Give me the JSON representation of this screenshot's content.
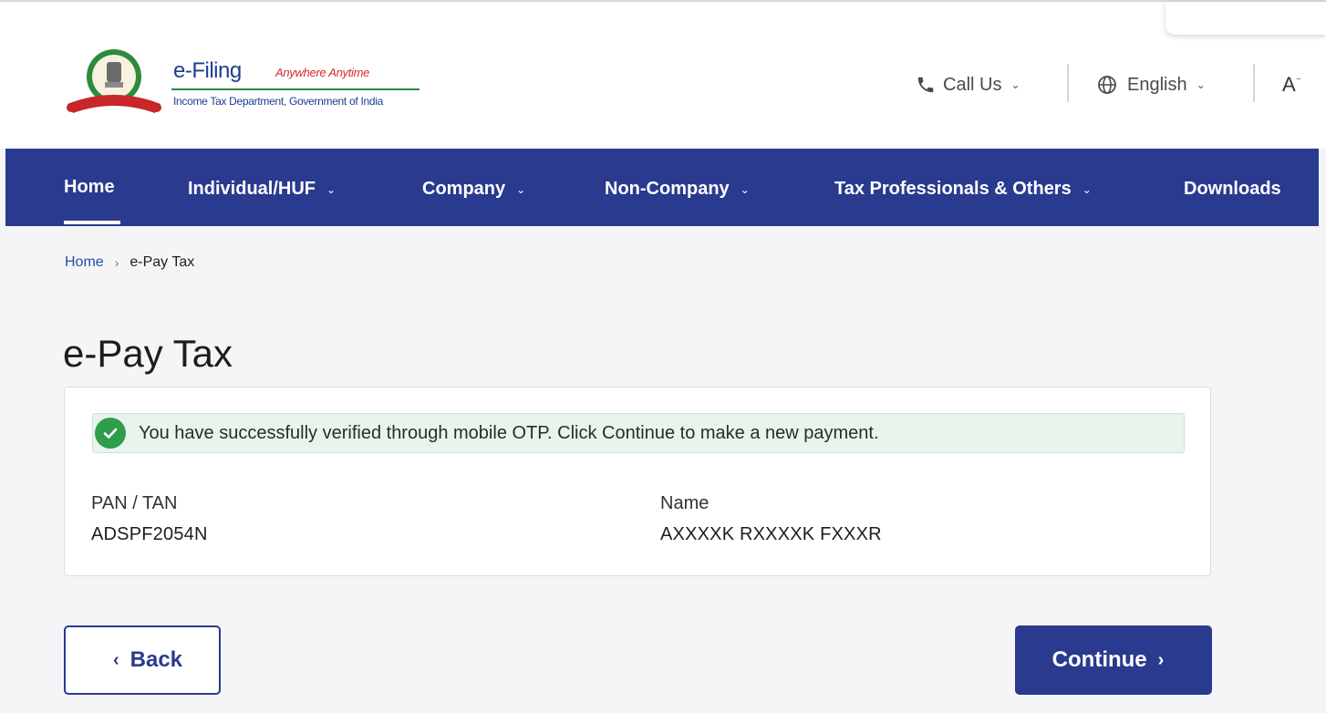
{
  "header": {
    "logo": {
      "title": "e-Filing",
      "tagline": "Anywhere Anytime",
      "subtitle": "Income Tax Department, Government of India"
    },
    "call_us": "Call Us",
    "language": "English",
    "font_size_icon": "A",
    "icons": {
      "call": "phone-icon",
      "language": "globe-icon",
      "font_size": "text-size-icon"
    }
  },
  "nav": {
    "items": [
      {
        "label": "Home",
        "active": true
      },
      {
        "label": "Individual/HUF",
        "dropdown": true
      },
      {
        "label": "Company",
        "dropdown": true
      },
      {
        "label": "Non-Company",
        "dropdown": true
      },
      {
        "label": "Tax Professionals & Others",
        "dropdown": true
      },
      {
        "label": "Downloads"
      }
    ]
  },
  "breadcrumb": {
    "home": "Home",
    "separator": "›",
    "current": "e-Pay Tax"
  },
  "page": {
    "title": "e-Pay Tax"
  },
  "alert": {
    "message": "You have successfully verified through mobile OTP. Click Continue to make a new payment.",
    "type": "success"
  },
  "details": {
    "pan_label": "PAN / TAN",
    "pan_value": "ADSPF2054N",
    "name_label": "Name",
    "name_value": "AXXXXK RXXXXK FXXXR"
  },
  "buttons": {
    "back": "Back",
    "continue": "Continue"
  },
  "colors": {
    "brand": "#2a3a8f",
    "success": "#2e9e4a",
    "alert_bg": "#e9f5ec"
  }
}
